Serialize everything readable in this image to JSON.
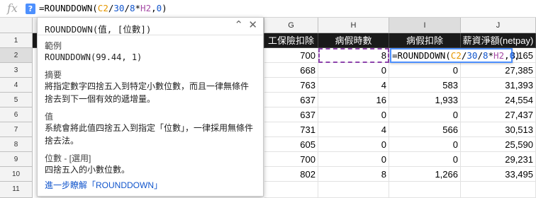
{
  "formula_bar": {
    "fx_label": "fx",
    "help_label": "?",
    "formula_prefix": "=ROUNDDOWN(",
    "formula_ref1": "C2",
    "formula_op1": "/",
    "formula_num1": "30",
    "formula_op2": "/",
    "formula_num2": "8",
    "formula_op3": "*",
    "formula_ref2": "H2",
    "formula_sep": ",",
    "formula_num3": "0",
    "formula_suffix": ")"
  },
  "columns": {
    "g": "G",
    "h": "H",
    "i": "I",
    "j": "J"
  },
  "rows": [
    "1",
    "2",
    "3",
    "4",
    "5",
    "6",
    "7",
    "8",
    "9",
    "10",
    "11"
  ],
  "headers": {
    "g": "工保險扣除",
    "h": "病假時數",
    "i": "病假扣除",
    "j": "薪資淨額(netpay)"
  },
  "table": [
    {
      "g": "700",
      "h": "8",
      "i": "",
      "j": "8,165"
    },
    {
      "g": "668",
      "h": "0",
      "i": "0",
      "j": "27,385"
    },
    {
      "g": "763",
      "h": "4",
      "i": "583",
      "j": "31,393"
    },
    {
      "g": "637",
      "h": "16",
      "i": "1,933",
      "j": "24,554"
    },
    {
      "g": "637",
      "h": "0",
      "i": "0",
      "j": "27,437"
    },
    {
      "g": "731",
      "h": "4",
      "i": "566",
      "j": "30,513"
    },
    {
      "g": "605",
      "h": "0",
      "i": "0",
      "j": "25,590"
    },
    {
      "g": "700",
      "h": "0",
      "i": "0",
      "j": "29,231"
    },
    {
      "g": "802",
      "h": "8",
      "i": "1,266",
      "j": "33,495"
    },
    {
      "g": "",
      "h": "",
      "i": "",
      "j": ""
    }
  ],
  "editor": {
    "prefix": "=ROUNDDOWN(",
    "ref1": "C2",
    "op1": "/",
    "num1": "30",
    "op2": "/",
    "num2": "8",
    "op3": "*",
    "ref2": "H2",
    "sep": ",",
    "num3": "0",
    "suffix": ")"
  },
  "popup": {
    "title": "ROUNDDOWN(值, [位數])",
    "example_title": "範例",
    "example_body": "ROUNDDOWN(99.44, 1)",
    "summary_title": "摘要",
    "summary_body": "將指定數字四捨五入到特定小數位數，而且一律無條件捨去到下一個有效的遞增量。",
    "value_title": "值",
    "value_body": "系統會將此值四捨五入到指定「位數」，一律採用無條件捨去法。",
    "places_title": "位數 - [選用]",
    "places_body": "四捨五入的小數位數。",
    "link": "進一步瞭解「ROUNDDOWN」",
    "collapse_icon": "chevron-up-icon",
    "close_icon": "close-icon"
  },
  "colors": {
    "ref1": "#e59700",
    "ref2": "#a64ca6",
    "number": "#1155cc",
    "accent": "#4d90fe"
  }
}
